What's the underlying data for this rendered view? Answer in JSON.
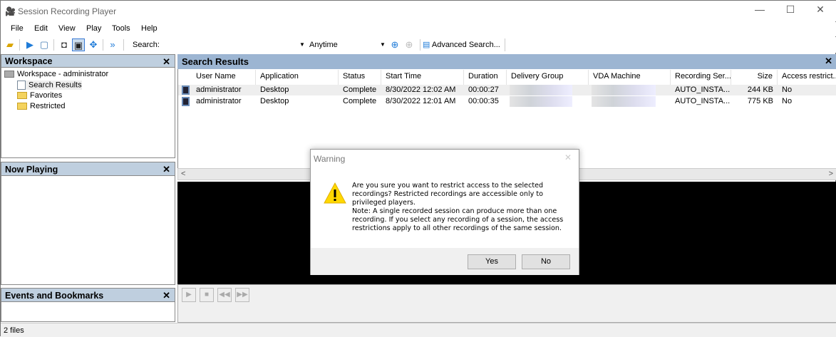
{
  "window": {
    "title": "Session Recording Player",
    "minimize": "—",
    "maximize": "☐",
    "close": "✕"
  },
  "menu": [
    "File",
    "Edit",
    "View",
    "Play",
    "Tools",
    "Help"
  ],
  "toolbar": {
    "search_label": "Search:",
    "search_value": "",
    "time_filter": "Anytime",
    "advanced_search": "Advanced Search..."
  },
  "workspace": {
    "title": "Workspace",
    "close": "✕",
    "root": "Workspace - administrator",
    "items": [
      "Search Results",
      "Favorites",
      "Restricted"
    ]
  },
  "now_playing": {
    "title": "Now Playing",
    "close": "✕"
  },
  "events": {
    "title": "Events and Bookmarks",
    "close": "✕"
  },
  "search_results": {
    "title": "Search Results",
    "close": "✕",
    "columns": [
      "User Name",
      "Application",
      "Status",
      "Start Time",
      "Duration",
      "Delivery Group",
      "VDA Machine",
      "Recording Ser...",
      "Size",
      "Access restrict..."
    ],
    "rows": [
      [
        "administrator",
        "Desktop",
        "Complete",
        "8/30/2022 12:02 AM",
        "00:00:27",
        "",
        "",
        "AUTO_INSTA...",
        "244 KB",
        "No"
      ],
      [
        "administrator",
        "Desktop",
        "Complete",
        "8/30/2022 12:01 AM",
        "00:00:35",
        "",
        "",
        "AUTO_INSTA...",
        "775 KB",
        "No"
      ]
    ]
  },
  "dialog": {
    "title": "Warning",
    "close": "✕",
    "icon": "warning-icon",
    "message": "Are you sure you want to restrict access to the selected recordings? Restricted recordings are accessible only to privileged players.",
    "note": "Note: A single recorded session can produce more than one recording. If you select any recording of a session, the access restrictions apply to all other recordings of the same session.",
    "yes": "Yes",
    "no": "No"
  },
  "status": {
    "text": "2 files"
  }
}
